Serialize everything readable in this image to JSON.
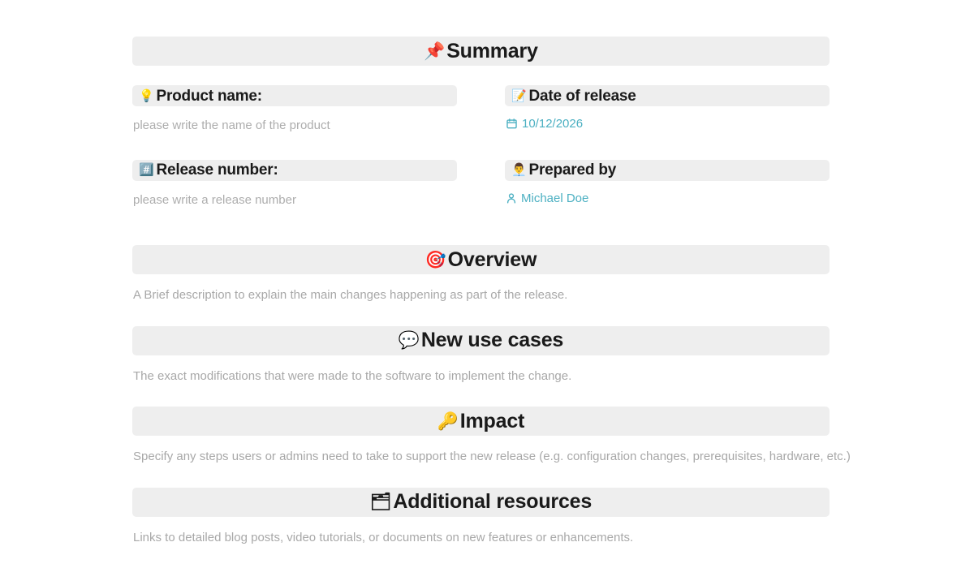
{
  "document": {
    "summary": {
      "icon": "pushpin-emoji",
      "glyph": "📌",
      "title": "Summary"
    },
    "fields": [
      {
        "name": "product-name",
        "icon": "light-bulb-emoji",
        "glyph": "💡",
        "label": "Product name:",
        "placeholder": "please write the name of the product"
      },
      {
        "name": "date-of-release",
        "icon": "memo-emoji",
        "glyph": "📝",
        "label": "Date of release",
        "value": "10/12/2026",
        "value_icon": "calendar-icon"
      },
      {
        "name": "release-number",
        "icon": "hash-key-emoji",
        "glyph": "#️⃣",
        "label": "Release number:",
        "placeholder": "please write a release number"
      },
      {
        "name": "prepared-by",
        "icon": "office-worker-emoji",
        "glyph": "👨‍💼",
        "label": "Prepared by",
        "value": "Michael Doe",
        "value_icon": "person-icon"
      }
    ],
    "sections": [
      {
        "name": "overview",
        "icon": "direct-hit-emoji",
        "glyph": "🎯",
        "title": "Overview",
        "description": "A Brief description to explain the main changes happening as part of the release."
      },
      {
        "name": "new-use-cases",
        "icon": "speech-balloon-emoji",
        "glyph": "💬",
        "title": "New use cases",
        "description": "The exact modifications that were made to the software to implement the change."
      },
      {
        "name": "impact",
        "icon": "key-emoji",
        "glyph": "🔑",
        "title": "Impact",
        "description": "Specify any steps users or admins need to take to support the new release (e.g. configuration changes, prerequisites, hardware, etc.)"
      },
      {
        "name": "additional-resources",
        "icon": "card-index-dividers-emoji",
        "glyph": "🗂",
        "title": "Additional resources",
        "description": "Links to detailed blog posts, video tutorials, or documents on new features or enhancements."
      }
    ],
    "colors": {
      "bar_background": "#eeeeee",
      "accent_teal": "#4cb0c2",
      "placeholder_gray": "#adadad",
      "heading_black": "#1a1a1a"
    }
  }
}
